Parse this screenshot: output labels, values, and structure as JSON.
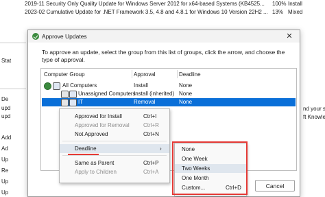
{
  "background": {
    "rows": [
      {
        "title": "2019-11 Security Only Quality Update for Windows Server 2012 for x64-based Systems (KB4525...",
        "percent": "100%",
        "status": "Install"
      },
      {
        "title": "2023-02 Cumulative Update for .NET Framework 3.5, 4.8 and 4.8.1 for Windows 10 Version 22H2 ...",
        "percent": "13%",
        "status": "Mixed"
      }
    ],
    "left_labels": [
      "Stat",
      "De",
      "upd",
      "upd",
      "Add",
      "Ad",
      "Up",
      "Re",
      "Up",
      "Up"
    ],
    "right_texts": [
      "nd your syst",
      "ft Knowled"
    ]
  },
  "dialog": {
    "title": "Approve Updates",
    "close_glyph": "✕",
    "instruction": "To approve an update, select the group from this list of groups, click the arrow, and choose the type of approval.",
    "columns": {
      "group": "Computer Group",
      "approval": "Approval",
      "deadline": "Deadline"
    },
    "rows": [
      {
        "group": "All Computers",
        "approval": "Install",
        "deadline": "None"
      },
      {
        "group": "Unassigned Computers",
        "approval": "Install (inherited)",
        "deadline": "None"
      },
      {
        "group": "IT",
        "approval": "Removal",
        "deadline": "None"
      }
    ],
    "cancel_label": "Cancel"
  },
  "context_menu": {
    "items": [
      {
        "label": "Approved for Install",
        "shortcut": "Ctrl+I"
      },
      {
        "label": "Approved for Removal",
        "shortcut": "Ctrl+R"
      },
      {
        "label": "Not Approved",
        "shortcut": "Ctrl+N"
      },
      {
        "label": "Deadline",
        "arrow": "›"
      },
      {
        "label": "Same as Parent",
        "shortcut": "Ctrl+P"
      },
      {
        "label": "Apply to Children",
        "shortcut": "Ctrl+A"
      }
    ]
  },
  "deadline_submenu": {
    "items": [
      {
        "label": "None"
      },
      {
        "label": "One Week"
      },
      {
        "label": "Two Weeks"
      },
      {
        "label": "One Month"
      },
      {
        "label": "Custom...",
        "shortcut": "Ctrl+D"
      }
    ]
  },
  "colors": {
    "selection": "#0a6fd8",
    "highlight_box": "#e53935",
    "approved_icon": "#3b8a3e"
  }
}
